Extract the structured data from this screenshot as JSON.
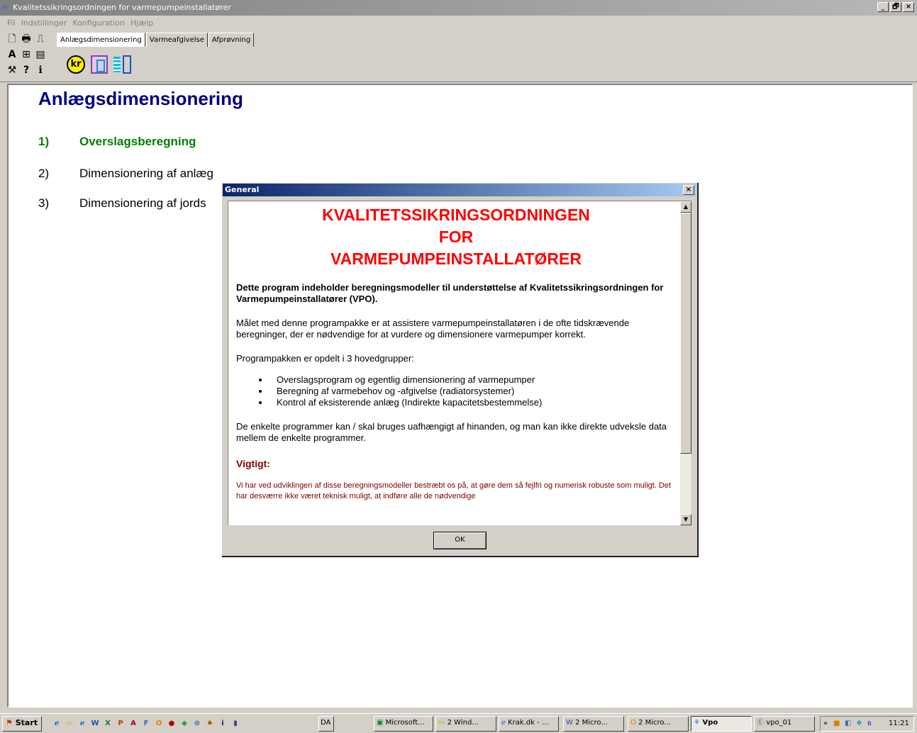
{
  "window": {
    "title": "Kvalitetssikringsordningen for varmepumpeinstallatører",
    "min": "_",
    "max": "🗗",
    "close": "×"
  },
  "menu": [
    "Fil",
    "Indstillinger",
    "Konfiguration",
    "Hjælp"
  ],
  "tabs": [
    "Anlægsdimensionering",
    "Varmeafgivelse",
    "Afprøvning"
  ],
  "toolbar": {
    "kr_label": "kr"
  },
  "main": {
    "title": "Anlægsdimensionering",
    "steps": [
      {
        "num": "1)",
        "label": "Overslagsberegning"
      },
      {
        "num": "2)",
        "label": "Dimensionering af anlæg"
      },
      {
        "num": "3)",
        "label": "Dimensionering af jords"
      }
    ]
  },
  "dialog": {
    "title": "General",
    "close": "×",
    "splash": [
      "KVALITETSSIKRINGSORDNINGEN",
      "FOR",
      "VARMEPUMPEINSTALLATØRER"
    ],
    "intro": "Dette program indeholder beregningsmodeller til understøttelse af Kvalitetssikringsordningen for Varmepumpeinstallatører (VPO).",
    "p1": "Målet med denne programpakke er at assistere varmepumpeinstallatøren i de ofte tidskrævende beregninger, der er nødvendige for at vurdere og dimensionere varmepumper korrekt.",
    "p2": "Programpakken er opdelt i 3 hovedgrupper:",
    "bullets": [
      "Overslagsprogram og egentlig dimensionering af varmepumper",
      "Beregning af varmebehov og -afgivelse (radiatorsystemer)",
      "Kontrol af eksisterende anlæg (Indirekte kapacitetsbestemmelse)"
    ],
    "p3": "De enkelte programmer kan / skal bruges uafhængigt af hinanden, og man kan ikke direkte udveksle data mellem de enkelte programmer.",
    "important_heading": "Vigtigt:",
    "important_text": "Vi har ved udviklingen af disse beregningsmodeller bestræbt os på, at gøre dem så fejlfri og numerisk robuste som muligt. Det har desværre ikke været teknisk muligt, at indføre alle de nødvendige",
    "ok": "OK"
  },
  "taskbar": {
    "start": "Start",
    "lang": "DA",
    "tasks": [
      "Microsoft...",
      "2 Wind...",
      "Krak.dk - ...",
      "2 Micro...",
      "2 Micro...",
      "Vpo",
      "vpo_01"
    ],
    "clock": "11:21"
  }
}
